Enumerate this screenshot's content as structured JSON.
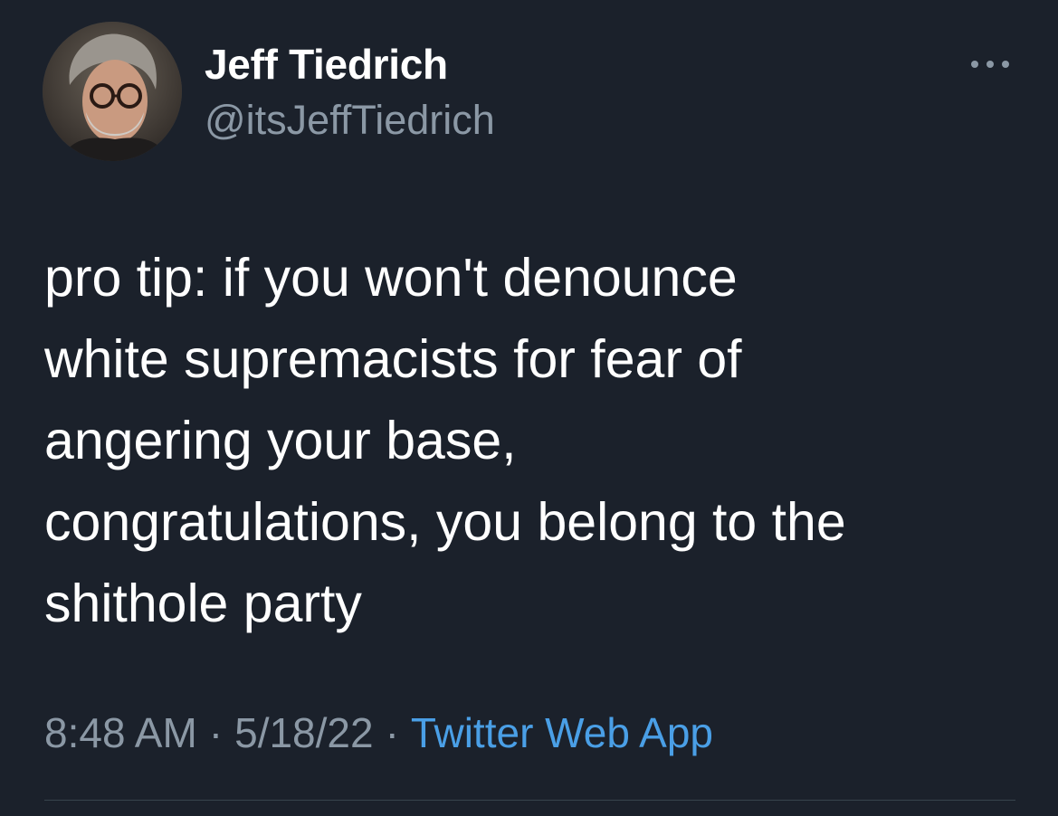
{
  "tweet": {
    "author": {
      "display_name": "Jeff Tiedrich",
      "handle": "@itsJeffTiedrich",
      "avatar_icon": "profile-photo"
    },
    "more_icon": "ellipsis-icon",
    "text": "pro tip: if you won't denounce\nwhite supremacists for fear of\nangering your base,\ncongratulations, you belong to the\nshithole party",
    "time": "8:48 AM",
    "separator": "·",
    "date": "5/18/22",
    "source": "Twitter Web App"
  },
  "colors": {
    "background": "#1b212b",
    "primary_text": "#ffffff",
    "secondary_text": "#8b98a5",
    "link": "#4a9fe6",
    "divider": "#38444d"
  }
}
